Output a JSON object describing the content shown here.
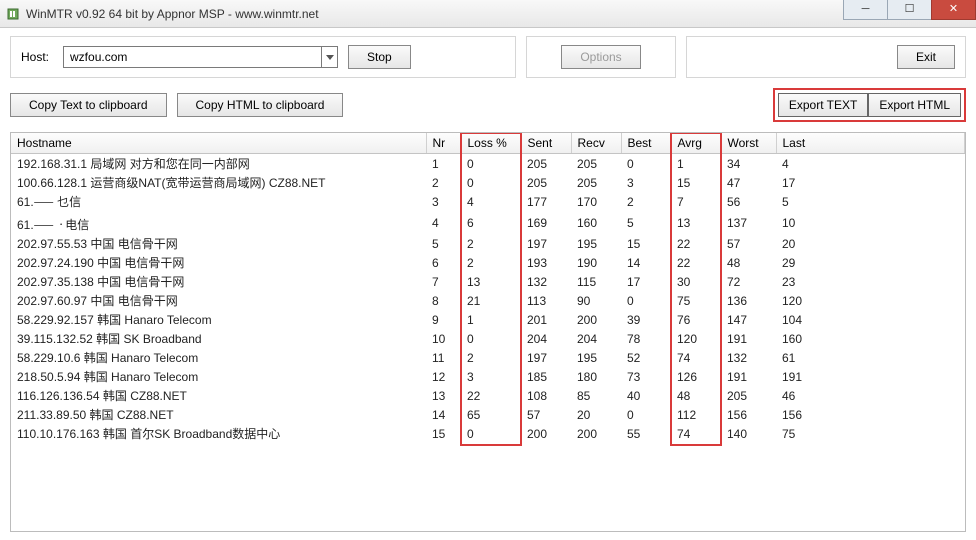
{
  "window": {
    "title": "WinMTR v0.92 64 bit by Appnor MSP - www.winmtr.net"
  },
  "toolbar": {
    "host_label": "Host:",
    "host_value": "wzfou.com",
    "stop": "Stop",
    "options": "Options",
    "exit": "Exit",
    "copy_text": "Copy Text to clipboard",
    "copy_html": "Copy HTML to clipboard",
    "export_text": "Export TEXT",
    "export_html": "Export HTML"
  },
  "columns": {
    "hostname": "Hostname",
    "nr": "Nr",
    "loss": "Loss %",
    "sent": "Sent",
    "recv": "Recv",
    "best": "Best",
    "avrg": "Avrg",
    "worst": "Worst",
    "last": "Last"
  },
  "rows": [
    {
      "host": "192.168.31.1 局域网 对方和您在同一内部网",
      "nr": "1",
      "loss": "0",
      "sent": "205",
      "recv": "205",
      "best": "0",
      "avrg": "1",
      "worst": "34",
      "last": "4"
    },
    {
      "host": "100.66.128.1 运营商级NAT(宽带运营商局域网)  CZ88.NET",
      "nr": "2",
      "loss": "0",
      "sent": "205",
      "recv": "205",
      "best": "3",
      "avrg": "15",
      "worst": "47",
      "last": "17"
    },
    {
      "host": "61.⸺                              乜信",
      "nr": "3",
      "loss": "4",
      "sent": "177",
      "recv": "170",
      "best": "2",
      "avrg": "7",
      "worst": "56",
      "last": "5"
    },
    {
      "host": "61.⸺                         ᠂ 电信",
      "nr": "4",
      "loss": "6",
      "sent": "169",
      "recv": "160",
      "best": "5",
      "avrg": "13",
      "worst": "137",
      "last": "10"
    },
    {
      "host": "202.97.55.53 中国 电信骨干网",
      "nr": "5",
      "loss": "2",
      "sent": "197",
      "recv": "195",
      "best": "15",
      "avrg": "22",
      "worst": "57",
      "last": "20"
    },
    {
      "host": "202.97.24.190 中国 电信骨干网",
      "nr": "6",
      "loss": "2",
      "sent": "193",
      "recv": "190",
      "best": "14",
      "avrg": "22",
      "worst": "48",
      "last": "29"
    },
    {
      "host": "202.97.35.138 中国 电信骨干网",
      "nr": "7",
      "loss": "13",
      "sent": "132",
      "recv": "115",
      "best": "17",
      "avrg": "30",
      "worst": "72",
      "last": "23"
    },
    {
      "host": "202.97.60.97 中国 电信骨干网",
      "nr": "8",
      "loss": "21",
      "sent": "113",
      "recv": "90",
      "best": "0",
      "avrg": "75",
      "worst": "136",
      "last": "120"
    },
    {
      "host": "58.229.92.157 韩国 Hanaro Telecom",
      "nr": "9",
      "loss": "1",
      "sent": "201",
      "recv": "200",
      "best": "39",
      "avrg": "76",
      "worst": "147",
      "last": "104"
    },
    {
      "host": "39.115.132.52 韩国 SK Broadband",
      "nr": "10",
      "loss": "0",
      "sent": "204",
      "recv": "204",
      "best": "78",
      "avrg": "120",
      "worst": "191",
      "last": "160"
    },
    {
      "host": "58.229.10.6 韩国 Hanaro Telecom",
      "nr": "11",
      "loss": "2",
      "sent": "197",
      "recv": "195",
      "best": "52",
      "avrg": "74",
      "worst": "132",
      "last": "61"
    },
    {
      "host": "218.50.5.94 韩国 Hanaro Telecom",
      "nr": "12",
      "loss": "3",
      "sent": "185",
      "recv": "180",
      "best": "73",
      "avrg": "126",
      "worst": "191",
      "last": "191"
    },
    {
      "host": "116.126.136.54 韩国  CZ88.NET",
      "nr": "13",
      "loss": "22",
      "sent": "108",
      "recv": "85",
      "best": "40",
      "avrg": "48",
      "worst": "205",
      "last": "46"
    },
    {
      "host": "211.33.89.50 韩国  CZ88.NET",
      "nr": "14",
      "loss": "65",
      "sent": "57",
      "recv": "20",
      "best": "0",
      "avrg": "112",
      "worst": "156",
      "last": "156"
    },
    {
      "host": "110.10.176.163 韩国 首尔SK Broadband数据中心",
      "nr": "15",
      "loss": "0",
      "sent": "200",
      "recv": "200",
      "best": "55",
      "avrg": "74",
      "worst": "140",
      "last": "75"
    }
  ]
}
